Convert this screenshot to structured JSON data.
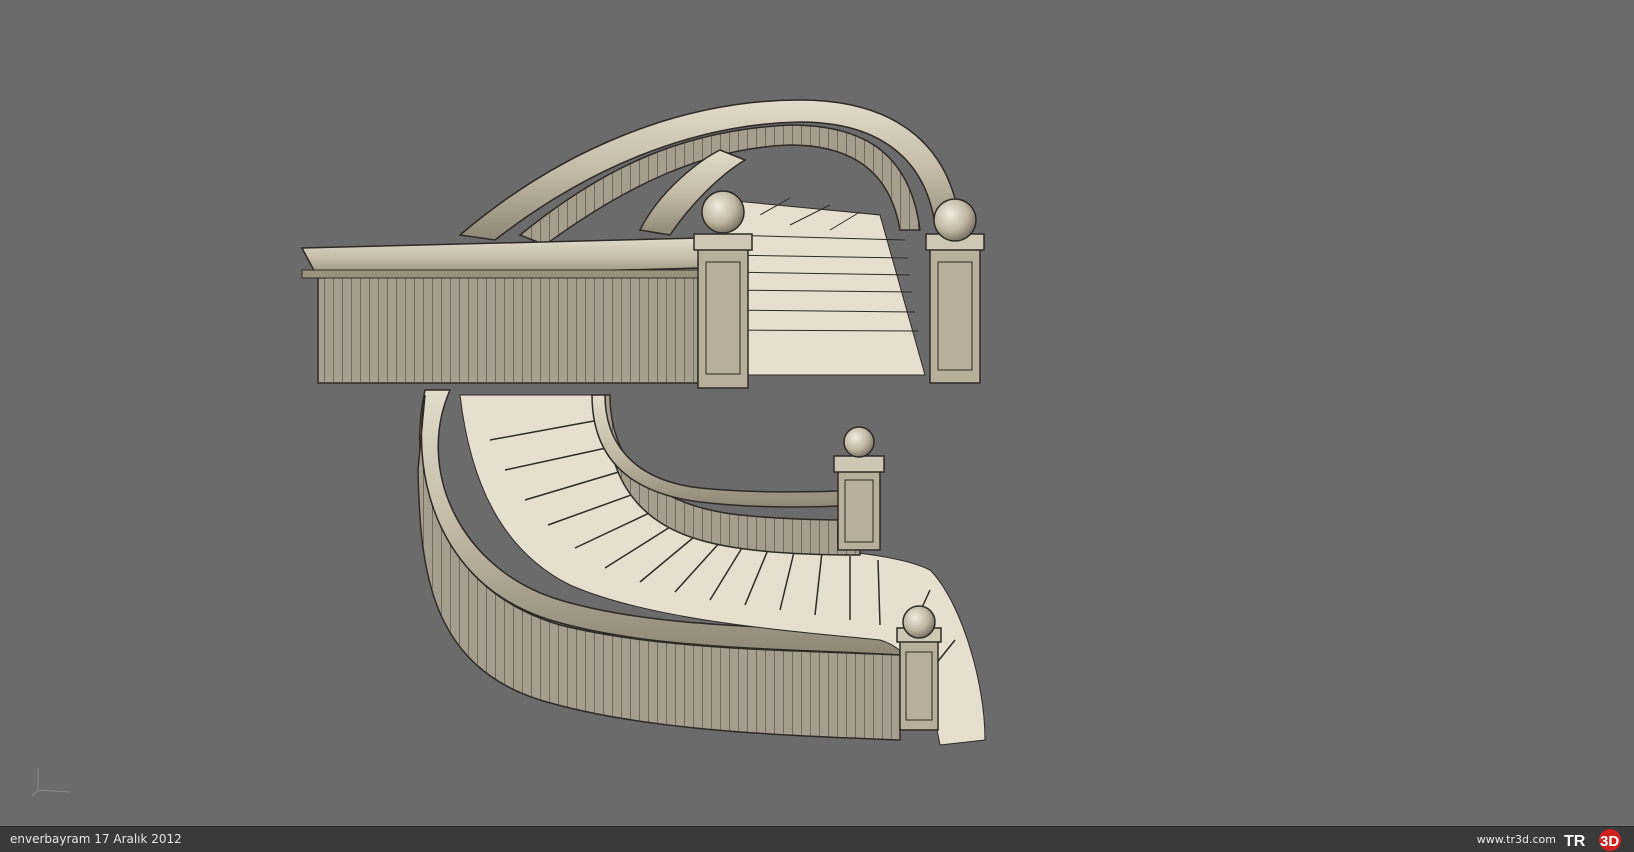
{
  "footer": {
    "caption": "enverbayram 17 Aralık 2012",
    "site": "www.tr3d.com"
  },
  "logo": {
    "text_white": "TR",
    "text_red": "3D",
    "colors": {
      "white": "#ffffff",
      "red": "#d21f1f"
    }
  },
  "colors": {
    "background": "#6b6b6b",
    "footer": "#3a3a3a",
    "stone": "#c9c0ad",
    "stone_light": "#ddd6c6",
    "stone_dark": "#8a8273",
    "tread": "#e6dfcf"
  },
  "icons": {
    "axis": "axis-gizmo-icon",
    "logo": "tr3d-logo-icon"
  }
}
